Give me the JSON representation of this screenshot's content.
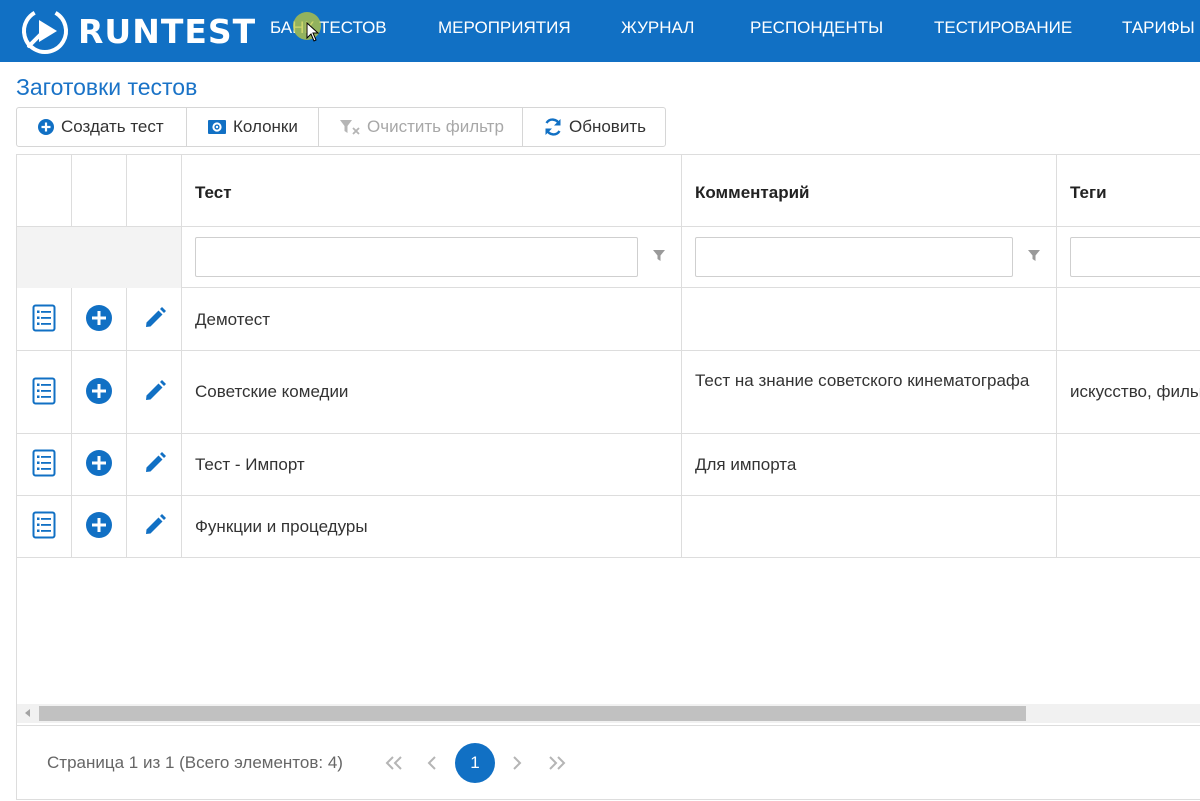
{
  "app": {
    "name": "RUNTEST"
  },
  "nav": {
    "items": [
      "БАНК ТЕСТОВ",
      "МЕРОПРИЯТИЯ",
      "ЖУРНАЛ",
      "РЕСПОНДЕНТЫ",
      "ТЕСТИРОВАНИЕ",
      "ТАРИФЫ"
    ],
    "active": "БАНК ТЕСТОВ"
  },
  "page": {
    "title": "Заготовки тестов"
  },
  "toolbar": {
    "create_label": "Создать тест",
    "columns_label": "Колонки",
    "clear_filter_label": "Очистить фильтр",
    "refresh_label": "Обновить"
  },
  "grid": {
    "columns": [
      "Тест",
      "Комментарий",
      "Теги"
    ],
    "filter_values": [
      "",
      "",
      ""
    ],
    "row_icons": [
      "list-icon",
      "plus-circle-icon",
      "pencil-icon"
    ],
    "rows": [
      {
        "test": "Демотест",
        "comment": "",
        "tags": ""
      },
      {
        "test": "Советские комедии",
        "comment": "Тест на знание советского кинематографа",
        "tags": "искусство, фильмы"
      },
      {
        "test": "Тест - Импорт",
        "comment": "Для импорта",
        "tags": ""
      },
      {
        "test": "Функции и процедуры",
        "comment": "",
        "tags": ""
      }
    ]
  },
  "pager": {
    "info": "Страница 1 из 1 (Всего элементов: 4)",
    "current_page": "1"
  },
  "colors": {
    "brand": "#1170c4",
    "title": "#1a73c7",
    "icon": "#1170c4"
  }
}
